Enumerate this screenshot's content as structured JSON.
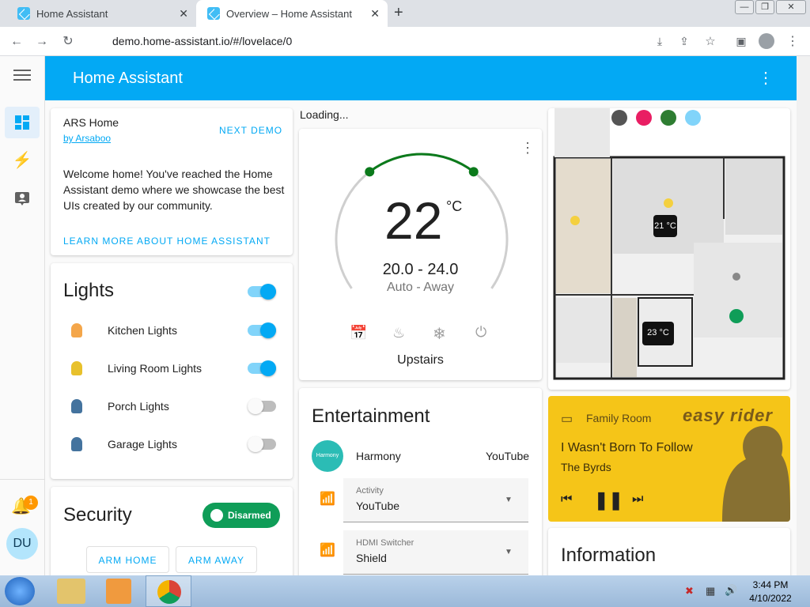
{
  "browser": {
    "tabs": [
      {
        "title": "Home Assistant"
      },
      {
        "title": "Overview – Home Assistant"
      }
    ],
    "url": "demo.home-assistant.io/#/lovelace/0"
  },
  "header": {
    "title": "Home Assistant"
  },
  "sidebar": {
    "notification_count": "1",
    "user_initials": "DU"
  },
  "intro": {
    "title": "ARS Home",
    "author": "by Arsaboo",
    "next_demo": "NEXT DEMO",
    "welcome": "Welcome home! You've reached the Home Assistant demo where we showcase the best UIs created by our community.",
    "learn_more": "LEARN MORE ABOUT HOME ASSISTANT"
  },
  "loading": "Loading...",
  "lights": {
    "title": "Lights",
    "items": [
      {
        "label": "Kitchen Lights",
        "on": true,
        "color": "#f4a64a"
      },
      {
        "label": "Living Room Lights",
        "on": true,
        "color": "#e8c12c"
      },
      {
        "label": "Porch Lights",
        "on": false,
        "color": "#44739e"
      },
      {
        "label": "Garage Lights",
        "on": false,
        "color": "#44739e"
      }
    ]
  },
  "security": {
    "title": "Security",
    "status": "Disarmed",
    "arm_home": "ARM HOME",
    "arm_away": "ARM AWAY"
  },
  "thermostat": {
    "temperature": "22",
    "unit": "°C",
    "range": "20.0 - 24.0",
    "mode": "Auto - Away",
    "name": "Upstairs",
    "range_low_fraction": 0.35,
    "range_high_fraction": 0.65
  },
  "entertainment": {
    "title": "Entertainment",
    "harmony_logo": "Harmony",
    "harmony_label": "Harmony",
    "harmony_value": "YouTube",
    "activity_label": "Activity",
    "activity_value": "YouTube",
    "hdmi_label": "HDMI Switcher",
    "hdmi_value": "Shield"
  },
  "floorplan": {
    "temp1": "21 °C",
    "temp2": "23 °C"
  },
  "media": {
    "source": "Family Room",
    "title": "I Wasn't Born To Follow",
    "artist": "The Byrds",
    "art_title": "easy rider"
  },
  "information": {
    "title": "Information"
  },
  "taskbar": {
    "time": "3:44 PM",
    "date": "4/10/2022"
  },
  "colors": {
    "accent": "#03a9f4",
    "security_green": "#0f9d58",
    "thermostat_green": "#0b7a1b"
  }
}
